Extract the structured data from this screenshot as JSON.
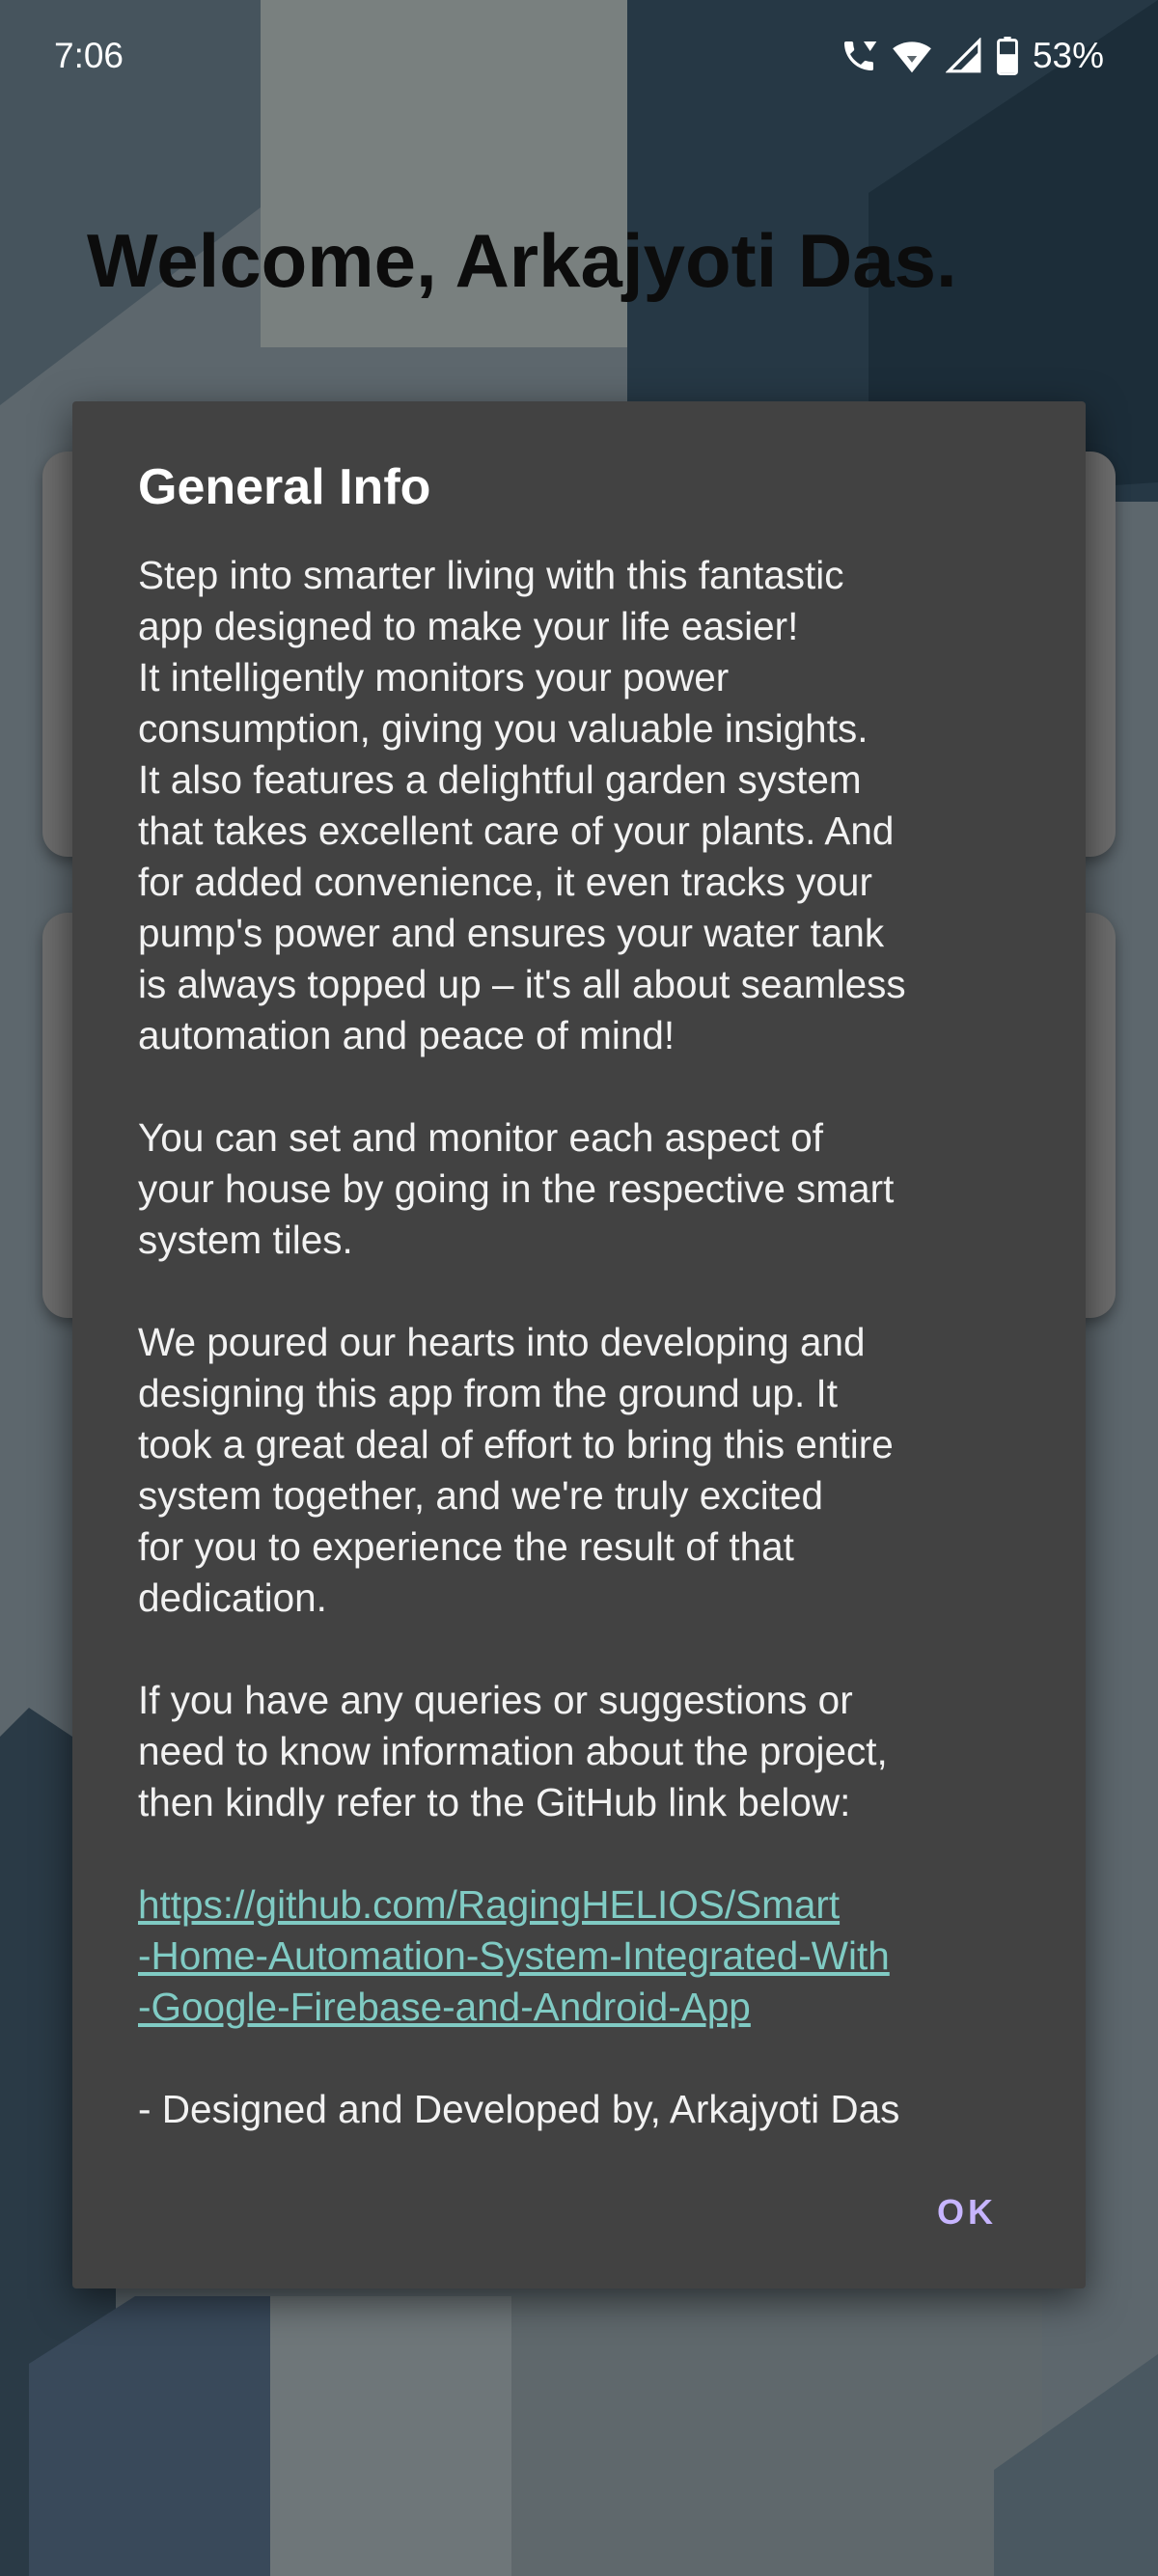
{
  "status_bar": {
    "time": "7:06",
    "icons": [
      "call-wifi-icon",
      "wifi-icon",
      "cellular-signal-icon",
      "battery-icon"
    ],
    "battery_percent": "53%"
  },
  "page": {
    "welcome_text": "Welcome, Arkajyoti Das."
  },
  "dialog": {
    "title": "General Info",
    "paragraphs": [
      "Step into smarter living with this fantastic\napp designed to make your life easier!\nIt intelligently monitors your power\nconsumption, giving you valuable insights.\nIt also features a delightful garden system\nthat takes excellent care of your plants. And\nfor added convenience, it even tracks your\npump's power and ensures your water tank\nis always topped up – it's all about seamless\nautomation and peace of mind!",
      "You can set and monitor each aspect of\nyour house by going in the respective smart\nsystem tiles.",
      "We poured our hearts into developing and\ndesigning this app from the ground up. It\ntook a great deal of effort to bring this entire\nsystem together, and we're truly excited\nfor you to experience the result of that\ndedication.",
      "If you have any queries or suggestions or\nneed to know information about the project,\nthen kindly refer to the GitHub link below:"
    ],
    "link": "https://github.com/RagingHELIOS/Smart\n-Home-Automation-System-Integrated-With\n-Google-Firebase-and-Android-App",
    "signature": "- Designed and Developed by, Arkajyoti Das",
    "ok_label": "OK"
  },
  "colors": {
    "dialog_background": "#424242",
    "link": "#80cbc4",
    "ok_button": "#c7b5ff",
    "page_background": "#5f6a70"
  }
}
